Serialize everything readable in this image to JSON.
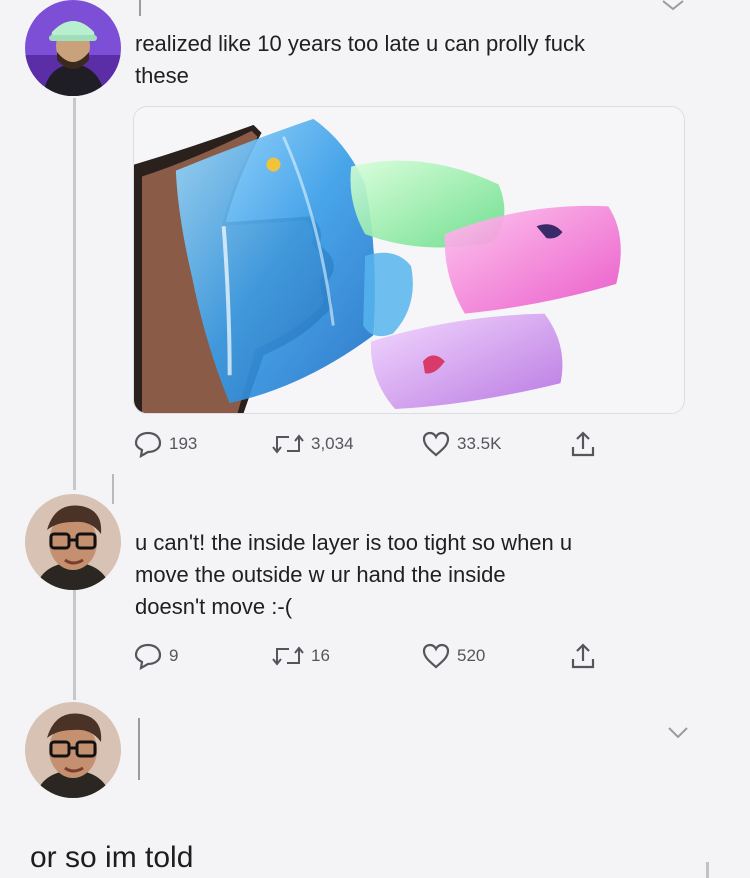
{
  "tweets": [
    {
      "avatar_icon": "profile-avatar-icon",
      "text": "realized like 10 years too late u can prolly fuck these",
      "text_lines": [
        "realized like 10 years too late u can prolly fuck",
        "these"
      ],
      "media_alt_icon": "water-snake-toys-photo",
      "reply_count": "193",
      "retweet_count": "3,034",
      "like_count": "33.5K"
    },
    {
      "avatar_icon": "profile-avatar-icon",
      "text_lines": [
        "u can't! the inside layer is too tight so when u",
        "move the outside w ur hand the inside",
        "doesn't move :-("
      ],
      "reply_count": "9",
      "retweet_count": "16",
      "like_count": "520"
    },
    {
      "avatar_icon": "profile-avatar-icon"
    }
  ],
  "caption": "or so im told",
  "colors": {
    "background": "#f4f4f6",
    "text": "#202024",
    "icon": "#55555c",
    "thread_line": "#c8c8cc"
  }
}
